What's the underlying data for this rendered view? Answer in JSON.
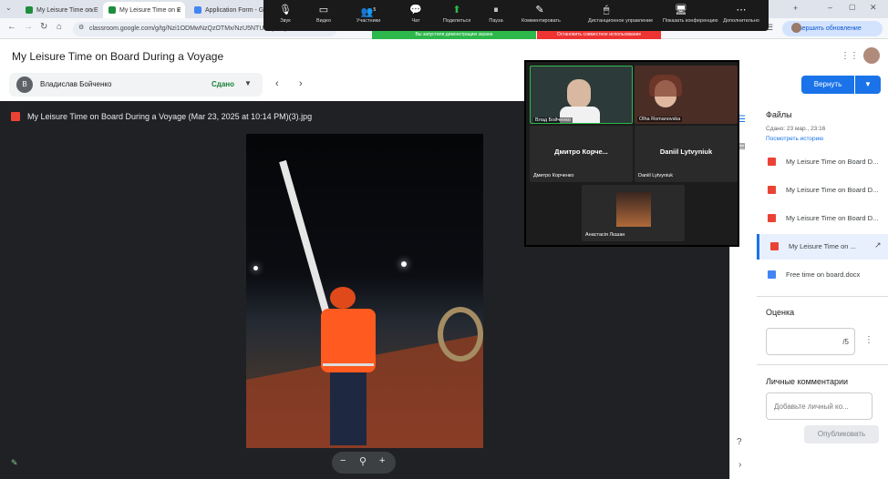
{
  "browser": {
    "tabs": [
      {
        "label": "My Leisure Time on E"
      },
      {
        "label": "My Leisure Time on E"
      },
      {
        "label": "Application Form - G"
      }
    ],
    "url": "classroom.google.com/g/tg/Nzi1ODMwNzQzOTMx/NzU5NTU5MjI1MjUz#u=NzI5ODk4...",
    "resume_label": "Завершить обновление"
  },
  "zoom": {
    "items": [
      {
        "label": "Звук",
        "icon": "microphone-icon"
      },
      {
        "label": "Видео",
        "icon": "video-icon"
      },
      {
        "label": "Участники",
        "icon": "participants-icon",
        "badge": "5"
      },
      {
        "label": "Чат",
        "icon": "chat-icon"
      },
      {
        "label": "Поделиться",
        "icon": "share-icon"
      },
      {
        "label": "Пауза",
        "icon": "pause-icon"
      },
      {
        "label": "Комментировать",
        "icon": "annotate-icon"
      },
      {
        "label": "Дистанционное управление",
        "icon": "remote-control-icon"
      },
      {
        "label": "Показать конференцию",
        "icon": "show-meeting-icon"
      },
      {
        "label": "Дополнительно",
        "icon": "more-icon"
      }
    ],
    "share_notice": "Вы запустили демонстрацию экрана",
    "stop_share": "Остановить совместное использование",
    "participants": {
      "p1_label": "Влад Бойченко",
      "p2_label": "Olha Romanovska",
      "p3_big": "Дмитро  Корче...",
      "p3_label": "Дмитро Корченко",
      "p4_big": "Daniil Lytvyniuk",
      "p4_label": "Daniil Lytvyniuk",
      "p5_label": "Анастасія Лєшан"
    }
  },
  "page": {
    "title": "My Leisure Time on Board During a Voyage",
    "student_initial": "В",
    "student_name": "Владислав Бойченко",
    "status": "Сдано",
    "return_label": "Вернуть"
  },
  "viewer": {
    "filename": "My Leisure Time on Board During a Voyage (Mar 23, 2025 at 10:14 PM)(3).jpg",
    "zoom_minus": "−",
    "zoom_plus": "+"
  },
  "panel": {
    "files_title": "Файлы",
    "submitted": "Сдано: 23 мар., 23:16",
    "history_link": "Посмотреть историю",
    "files": [
      {
        "name": "My Leisure Time on Board D..."
      },
      {
        "name": "My Leisure Time on Board D..."
      },
      {
        "name": "My Leisure Time on Board D..."
      },
      {
        "name": "My Leisure Time on ..."
      },
      {
        "name": "Free time on board.docx"
      }
    ],
    "grade_title": "Оценка",
    "grade_value": "/5",
    "comments_title": "Личные комментарии",
    "comment_placeholder": "Добавьте личный ко...",
    "publish_label": "Опубликовать"
  }
}
